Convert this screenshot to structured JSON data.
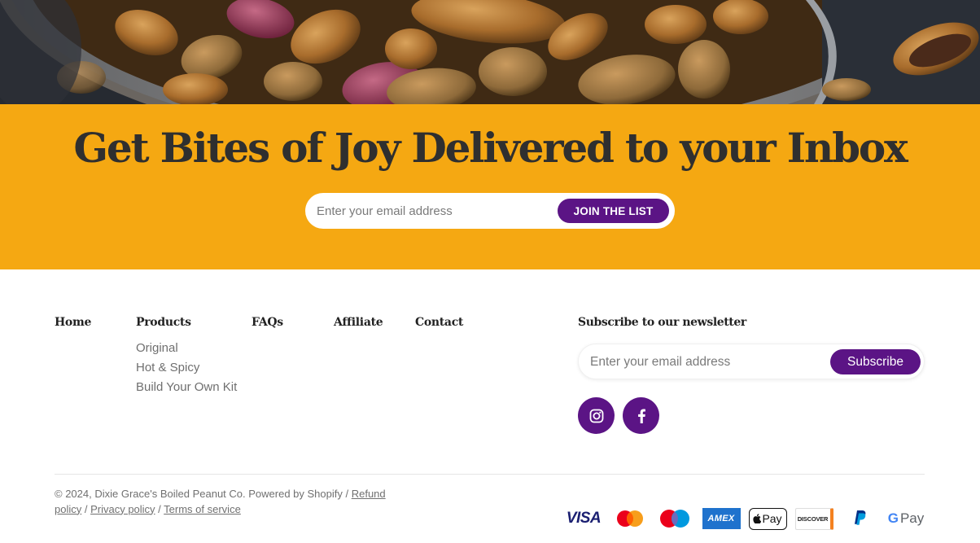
{
  "band": {
    "heading": "Get Bites of Joy Delivered to your Inbox",
    "email_placeholder": "Enter your email address",
    "join_label": "JOIN THE LIST"
  },
  "footer": {
    "nav": {
      "home": "Home",
      "products": "Products",
      "faqs": "FAQs",
      "affiliate": "Affiliate",
      "contact": "Contact"
    },
    "products_items": [
      "Original",
      "Hot & Spicy",
      "Build Your Own Kit"
    ],
    "newsletter": {
      "heading": "Subscribe to our newsletter",
      "placeholder": "Enter your email address",
      "button_label": "Subscribe"
    },
    "social": [
      {
        "icon": "instagram-icon"
      },
      {
        "icon": "facebook-icon"
      }
    ],
    "legal": {
      "copyright": "© 2024, Dixie Grace's Boiled Peanut Co. Powered by Shopify",
      "sep1": " / ",
      "refund": "Refund policy",
      "sep2": " / ",
      "privacy": "Privacy policy",
      "sep3": " / ",
      "terms": "Terms of service"
    },
    "payments": {
      "visa": "VISA",
      "mastercard": "mastercard-icon",
      "maestro": "maestro-icon",
      "amex": "AMEX",
      "applepay": "Pay",
      "discover": "DISCOVER",
      "paypal": "paypal-icon",
      "gpay": "Pay"
    }
  },
  "colors": {
    "accent": "#5b1485",
    "band": "#f5a812",
    "text_dark": "#2f2f2f"
  }
}
